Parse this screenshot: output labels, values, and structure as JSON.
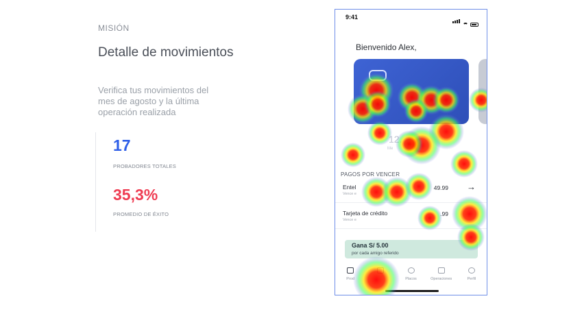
{
  "mission": {
    "tag": "MISIÓN",
    "title": "Detalle de movimientos",
    "description": "Verifica tus movimientos del mes de agosto y la última operación realizada"
  },
  "stats": {
    "testers_value": "17",
    "testers_label": "PROBADORES TOTALES",
    "success_value": "35,3%",
    "success_label": "PROMEDIO DE ÉXITO"
  },
  "phone": {
    "status_time": "9:41",
    "welcome": "Bienvenido Alex,",
    "card_amount": "12.",
    "card_sub": "Me",
    "section_title": "PAGOS POR VENCER",
    "payments": [
      {
        "name": "Entel",
        "sub": "Vence e",
        "amount": "49.99"
      },
      {
        "name": "Tarjeta de crédito",
        "sub": "Vence e",
        "amount": ".99"
      }
    ],
    "promo": {
      "title": "Gana S/ 5.00",
      "subtitle": "por cada amigo referido"
    },
    "nav": [
      {
        "label": "Prod",
        "icon": "wallet-icon"
      },
      {
        "label": "",
        "icon": "transfer-icon"
      },
      {
        "label": "Placos",
        "icon": "user-icon"
      },
      {
        "label": "Operaciones",
        "icon": "card-icon"
      },
      {
        "label": "Perfil",
        "icon": "profile-icon"
      }
    ]
  },
  "colors": {
    "accent_blue": "#2f5fe8",
    "accent_red": "#ef3d53",
    "card_blue": "#3e63d4",
    "promo_green": "#cfe9de"
  }
}
